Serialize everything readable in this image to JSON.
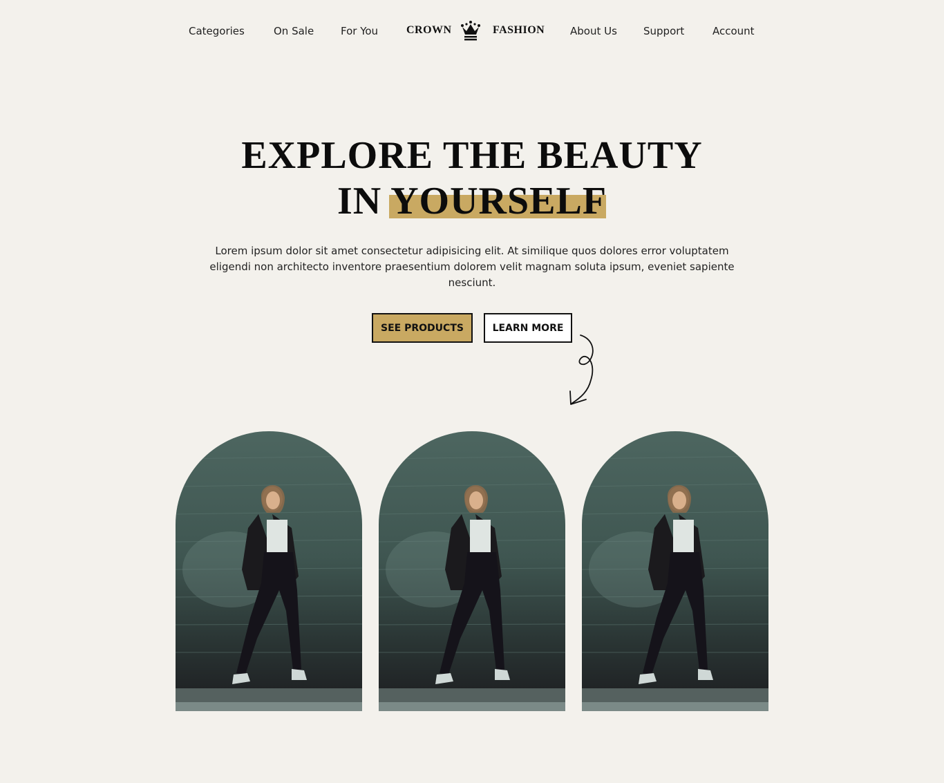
{
  "nav": {
    "left_links": [
      "Categories",
      "On Sale",
      "For You"
    ],
    "brand_left": "CROWN",
    "brand_right": "FASHION",
    "brand_icon": "crown-icon",
    "right_links": [
      "About Us",
      "Support",
      "Account"
    ]
  },
  "hero": {
    "title_line1": "EXPLORE THE BEAUTY",
    "title_line2_plain": "IN",
    "title_line2_highlight": "YOURSELF",
    "description": "Lorem ipsum dolor sit amet consectetur adipisicing elit. At similique quos dolores error voluptatem eligendi non architecto inventore praesentium dolorem velit magnam soluta ipsum, eveniet sapiente nesciunt.",
    "primary_button": "SEE PRODUCTS",
    "secondary_button": "LEARN MORE"
  },
  "gallery": {
    "items": [
      "fashion-model-photo",
      "fashion-model-photo",
      "fashion-model-photo"
    ]
  },
  "colors": {
    "background": "#f3f1ec",
    "accent": "#c9a962",
    "text": "#111111"
  }
}
